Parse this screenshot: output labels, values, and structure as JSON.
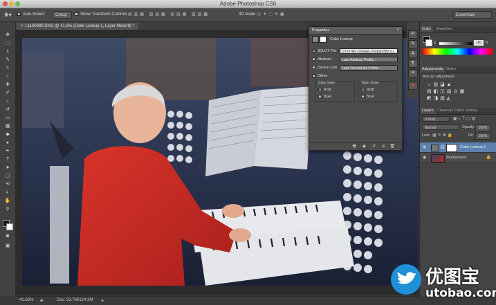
{
  "app": {
    "title": "Adobe Photoshop CS6"
  },
  "options_bar": {
    "auto_select_label": "Auto-Select:",
    "auto_select_value": "Group",
    "transform_label": "Show Transform Controls",
    "mode_3d": "3D Mode:",
    "workspace": "Essentials"
  },
  "document": {
    "tab_title": "L1190080.DNG @ 41.6% (Color Lookup 1, Layer Mask/8) *"
  },
  "status": {
    "zoom": "41.63%",
    "doc": "Doc: 53.7M/124.3M"
  },
  "properties": {
    "header": "Properties",
    "adjustment_name": "Color Lookup",
    "rows": [
      {
        "label": "3DLUT File",
        "value": "CTv3 film contrast_Kodak2392.cu...",
        "selected": true
      },
      {
        "label": "Abstract",
        "value": "Load Abstract Profile...",
        "selected": false
      },
      {
        "label": "Device Link",
        "value": "Load DeviceLink Profile...",
        "selected": false
      }
    ],
    "dither_label": "Dither",
    "data_order_label": "Data Order",
    "table_order_label": "Table Order",
    "data_order_options": [
      "RGB",
      "BGR"
    ],
    "table_order_options": [
      "RGB",
      "BGR"
    ]
  },
  "color_panel": {
    "tabs": [
      "Color",
      "Swatches"
    ],
    "channel": "K",
    "value": "100",
    "unit": "%"
  },
  "adjustments_panel": {
    "tabs": [
      "Adjustments",
      "Styles"
    ],
    "hint": "Add an adjustment"
  },
  "layers_panel": {
    "tabs": [
      "Layers",
      "Channels",
      "Paths",
      "History"
    ],
    "filter": "Kind",
    "blend_mode": "Normal",
    "opacity_label": "Opacity:",
    "opacity_value": "100%",
    "lock_label": "Lock:",
    "fill_label": "Fill:",
    "fill_value": "100%",
    "layers": [
      {
        "name": "Color Lookup 1",
        "selected": true
      },
      {
        "name": "Background",
        "selected": false
      }
    ]
  },
  "watermark": {
    "cn": "优图宝",
    "url": "utobao.com"
  },
  "colors": {
    "accent": "#3c74c4",
    "panel": "#4b4b4b",
    "selected_layer": "#5b7fae"
  }
}
